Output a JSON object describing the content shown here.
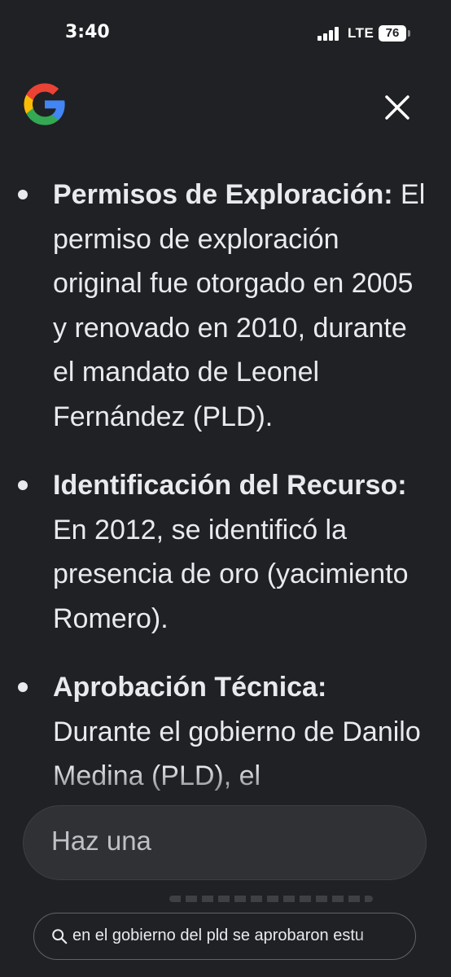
{
  "status_bar": {
    "time": "3:40",
    "network": "LTE",
    "battery": "76"
  },
  "header": {
    "logo": "google-logo",
    "close_icon": "close-icon"
  },
  "content": {
    "items": [
      {
        "title": "Permisos de Exploración:",
        "text": "El permiso de exploración original fue otorgado en 2005 y renovado en 2010, durante el mandato de Leonel Fernández (PLD)."
      },
      {
        "title": "Identificación del Recurso:",
        "text": "En 2012, se identificó la presencia de oro (yacimiento Romero)."
      },
      {
        "title": "Aprobación Técnica:",
        "text": "Durante el gobierno de Danilo Medina (PLD), el"
      }
    ]
  },
  "followup": {
    "placeholder": "Haz una"
  },
  "query": {
    "icon": "search-icon",
    "text": "en el gobierno del pld se aprobaron estu"
  },
  "colors": {
    "background": "#202124",
    "text": "#e8eaed",
    "input_bg": "#303134"
  }
}
